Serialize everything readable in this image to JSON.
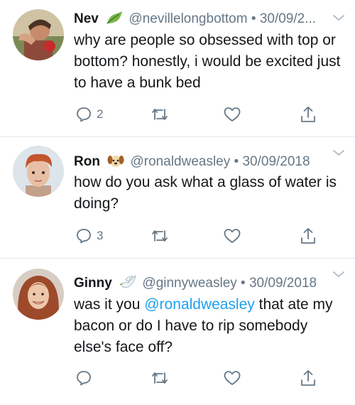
{
  "tweets": [
    {
      "name": "Nev",
      "handle": "@nevillelongbottom",
      "separator": "•",
      "date": "30/09/2...",
      "badge_icon": "leaf-emoji-icon",
      "text": "why are people so obsessed with top or bottom? honestly, i would be excited just to have a bunk bed",
      "replies": "2",
      "retweets": "",
      "likes": ""
    },
    {
      "name": "Ron",
      "handle": "@ronaldweasley",
      "separator": "•",
      "date": "30/09/2018",
      "badge_icon": "dog-face-emoji-icon",
      "text": "how do you ask what a glass of water is doing?",
      "replies": "3",
      "retweets": "",
      "likes": ""
    },
    {
      "name": "Ginny",
      "handle": "@ginnyweasley",
      "separator": "•",
      "date": "30/09/2018",
      "badge_icon": "dove-emoji-icon",
      "text_before": "was it you ",
      "mention": "@ronaldweasley",
      "text_after": " that ate my bacon or do I have to rip somebody else's face off?",
      "replies": "",
      "retweets": "",
      "likes": ""
    }
  ],
  "colors": {
    "text": "#14171a",
    "secondary": "#657786",
    "link": "#1da1f2",
    "divider": "#e1e8ed"
  }
}
